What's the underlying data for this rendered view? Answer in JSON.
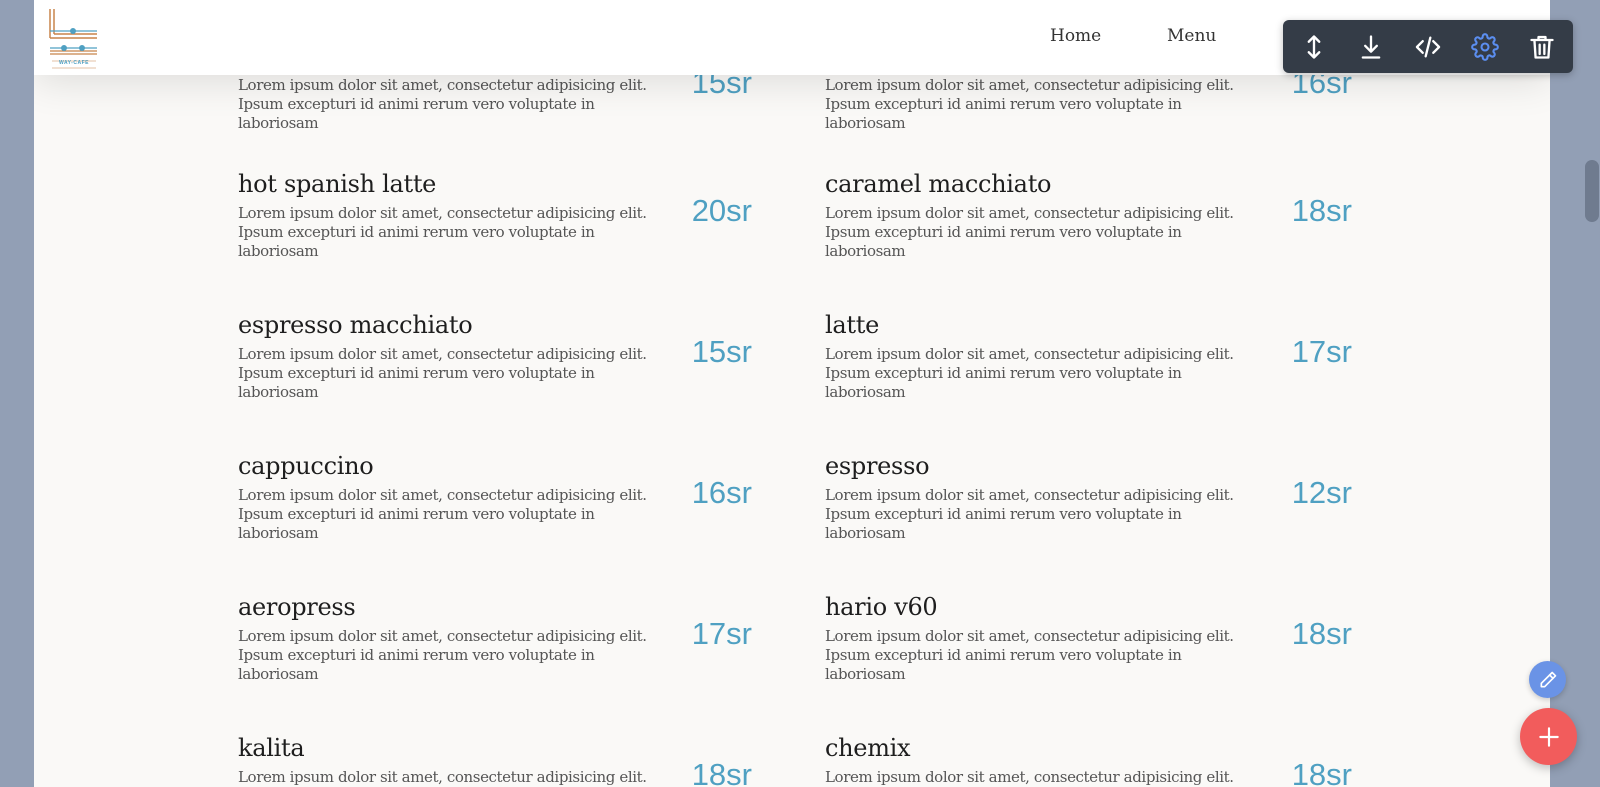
{
  "navbar": {
    "logo_text": "WAY-CAFE",
    "links": [
      {
        "label": "Home"
      },
      {
        "label": "Menu"
      }
    ]
  },
  "menu": {
    "items": [
      {
        "name": "",
        "desc": "Lorem ipsum dolor sit amet, consectetur adipisicing elit. Ipsum excepturi id animi rerum vero voluptate in laboriosam",
        "price": "15sr"
      },
      {
        "name": "",
        "desc": "Lorem ipsum dolor sit amet, consectetur adipisicing elit. Ipsum excepturi id animi rerum vero voluptate in laboriosam",
        "price": "16sr"
      },
      {
        "name": "hot spanish latte",
        "desc": "Lorem ipsum dolor sit amet, consectetur adipisicing elit. Ipsum excepturi id animi rerum vero voluptate in laboriosam",
        "price": "20sr"
      },
      {
        "name": "caramel macchiato",
        "desc": "Lorem ipsum dolor sit amet, consectetur adipisicing elit. Ipsum excepturi id animi rerum vero voluptate in laboriosam",
        "price": "18sr"
      },
      {
        "name": "espresso macchiato",
        "desc": "Lorem ipsum dolor sit amet, consectetur adipisicing elit. Ipsum excepturi id animi rerum vero voluptate in laboriosam",
        "price": "15sr"
      },
      {
        "name": "latte",
        "desc": "Lorem ipsum dolor sit amet, consectetur adipisicing elit. Ipsum excepturi id animi rerum vero voluptate in laboriosam",
        "price": "17sr"
      },
      {
        "name": "cappuccino",
        "desc": "Lorem ipsum dolor sit amet, consectetur adipisicing elit. Ipsum excepturi id animi rerum vero voluptate in laboriosam",
        "price": "16sr"
      },
      {
        "name": "espresso",
        "desc": "Lorem ipsum dolor sit amet, consectetur adipisicing elit. Ipsum excepturi id animi rerum vero voluptate in laboriosam",
        "price": "12sr"
      },
      {
        "name": "aeropress",
        "desc": "Lorem ipsum dolor sit amet, consectetur adipisicing elit. Ipsum excepturi id animi rerum vero voluptate in laboriosam",
        "price": "17sr"
      },
      {
        "name": "hario v60",
        "desc": "Lorem ipsum dolor sit amet, consectetur adipisicing elit. Ipsum excepturi id animi rerum vero voluptate in laboriosam",
        "price": "18sr"
      },
      {
        "name": "kalita",
        "desc": "Lorem ipsum dolor sit amet, consectetur adipisicing elit.",
        "price": "18sr"
      },
      {
        "name": "chemix",
        "desc": "Lorem ipsum dolor sit amet, consectetur adipisicing elit.",
        "price": "18sr"
      }
    ]
  },
  "toolbar": {
    "buttons": [
      {
        "icon": "move-vertical-icon"
      },
      {
        "icon": "download-icon"
      },
      {
        "icon": "code-icon"
      },
      {
        "icon": "gear-icon"
      },
      {
        "icon": "trash-icon"
      }
    ]
  },
  "colors": {
    "price": "#4fa0c2",
    "toolbar_bg": "#343c47",
    "gear_active": "#5b8ef0",
    "fab_add": "#f25c5c",
    "fab_edit": "#6a93e6",
    "outer_bg": "#929fb5"
  }
}
